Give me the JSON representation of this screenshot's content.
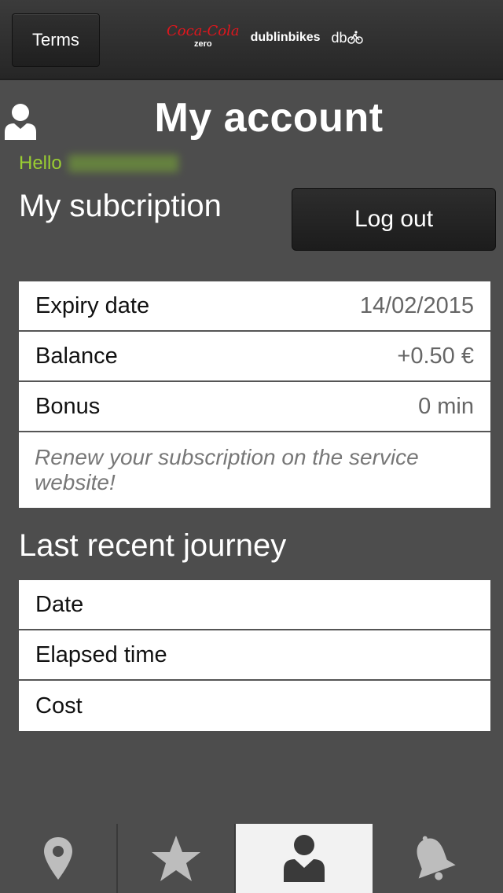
{
  "header": {
    "terms_label": "Terms",
    "brand": {
      "coke_text": "Coca-Cola",
      "coke_sub": "zero",
      "dublinbikes": "dublinbikes",
      "db": "db"
    }
  },
  "page": {
    "title": "My account",
    "hello_label": "Hello",
    "subscription_heading": "My subcription",
    "logout_label": "Log out"
  },
  "subscription": {
    "rows": [
      {
        "label": "Expiry date",
        "value": "14/02/2015"
      },
      {
        "label": "Balance",
        "value": "+0.50 €"
      },
      {
        "label": "Bonus",
        "value": "0 min"
      }
    ],
    "note": "Renew your subscription on the service website!"
  },
  "journey": {
    "heading": "Last recent journey",
    "rows": [
      {
        "label": "Date"
      },
      {
        "label": "Elapsed time"
      },
      {
        "label": "Cost"
      }
    ]
  },
  "tabbar": {
    "tabs": [
      {
        "icon": "map-pin-icon",
        "active": false
      },
      {
        "icon": "star-icon",
        "active": false
      },
      {
        "icon": "user-icon",
        "active": true
      },
      {
        "icon": "bell-icon",
        "active": false
      }
    ]
  },
  "colors": {
    "background": "#4d4d4d",
    "hello_green": "#9acd32",
    "active_tab": "#f2f2f2"
  }
}
